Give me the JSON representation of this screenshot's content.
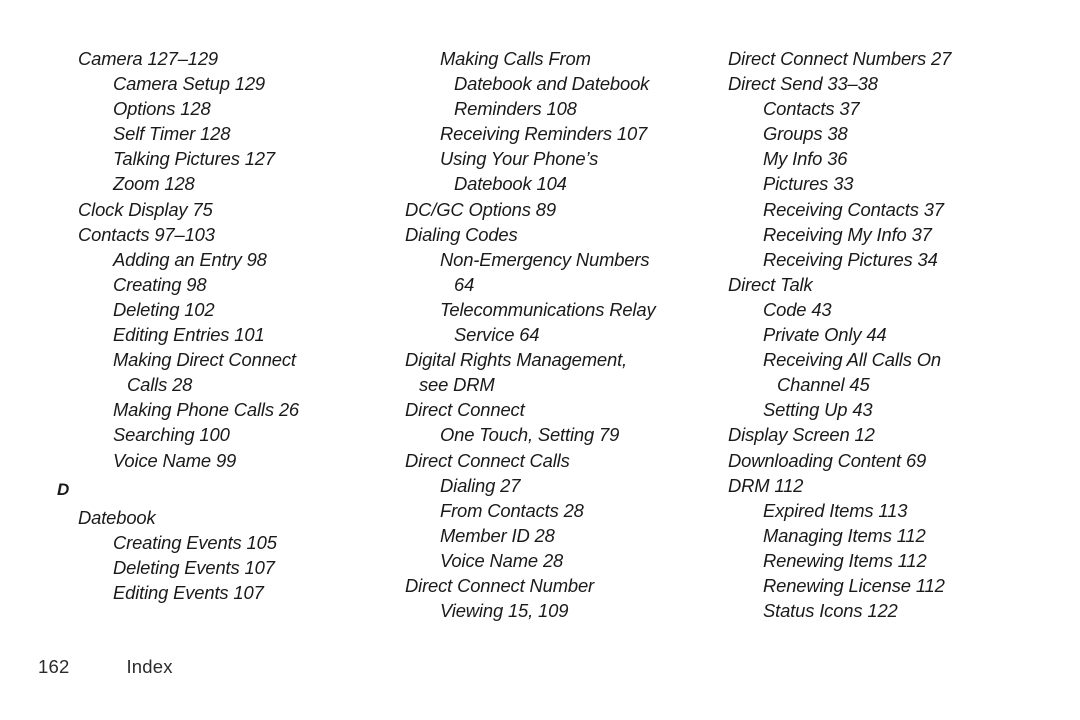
{
  "page": {
    "background_color": "#ffffff",
    "text_color": "#1a1a1a"
  },
  "footer": {
    "page_number": "162",
    "label": "Index"
  },
  "columns": [
    {
      "id": "column-1",
      "entries": [
        {
          "text": "Camera 127–129",
          "level": 1
        },
        {
          "text": "Camera Setup 129",
          "level": 2
        },
        {
          "text": "Options 128",
          "level": 2
        },
        {
          "text": "Self Timer 128",
          "level": 2
        },
        {
          "text": "Talking Pictures 127",
          "level": 2
        },
        {
          "text": "Zoom 128",
          "level": 2
        },
        {
          "text": "Clock Display 75",
          "level": 1
        },
        {
          "text": "Contacts 97–103",
          "level": 1
        },
        {
          "text": "Adding an Entry 98",
          "level": 2
        },
        {
          "text": "Creating 98",
          "level": 2
        },
        {
          "text": "Deleting 102",
          "level": 2
        },
        {
          "text": "Editing Entries 101",
          "level": 2
        },
        {
          "text": "Making Direct Connect Calls 28",
          "level": 2,
          "wrap": true
        },
        {
          "text": "Making Phone Calls 26",
          "level": 2
        },
        {
          "text": "Searching 100",
          "level": 2
        },
        {
          "text": "Voice Name 99",
          "level": 2
        },
        {
          "text": "D",
          "level": 0,
          "section": true
        },
        {
          "text": "Datebook",
          "level": 1
        },
        {
          "text": "Creating Events 105",
          "level": 2
        },
        {
          "text": "Deleting Events 107",
          "level": 2
        },
        {
          "text": "Editing Events 107",
          "level": 2
        }
      ]
    },
    {
      "id": "column-2",
      "entries": [
        {
          "text": "Making Calls From Datebook and Datebook Reminders 108",
          "level": 2,
          "wrap": true
        },
        {
          "text": "Receiving Reminders 107",
          "level": 2
        },
        {
          "text": "Using Your Phone’s Datebook 104",
          "level": 2,
          "wrap": true
        },
        {
          "text": "DC/GC Options 89",
          "level": 1
        },
        {
          "text": "Dialing Codes",
          "level": 1
        },
        {
          "text": "Non-Emergency Numbers 64",
          "level": 2,
          "wrap": true
        },
        {
          "text": "Telecommunications Relay Service 64",
          "level": 2,
          "wrap": true
        },
        {
          "text": "Digital Rights Management, see DRM",
          "level": 1,
          "wrap": true
        },
        {
          "text": "Direct Connect",
          "level": 1
        },
        {
          "text": "One Touch, Setting 79",
          "level": 2
        },
        {
          "text": "Direct Connect Calls",
          "level": 1
        },
        {
          "text": "Dialing 27",
          "level": 2
        },
        {
          "text": "From Contacts 28",
          "level": 2
        },
        {
          "text": "Member ID 28",
          "level": 2
        },
        {
          "text": "Voice Name 28",
          "level": 2
        },
        {
          "text": "Direct Connect Number",
          "level": 1
        },
        {
          "text": "Viewing 15, 109",
          "level": 2
        }
      ]
    },
    {
      "id": "column-3",
      "entries": [
        {
          "text": "Direct Connect Numbers 27",
          "level": 1
        },
        {
          "text": "Direct Send 33–38",
          "level": 1
        },
        {
          "text": "Contacts 37",
          "level": 2
        },
        {
          "text": "Groups 38",
          "level": 2
        },
        {
          "text": "My Info 36",
          "level": 2
        },
        {
          "text": "Pictures 33",
          "level": 2
        },
        {
          "text": "Receiving Contacts 37",
          "level": 2
        },
        {
          "text": "Receiving My Info 37",
          "level": 2
        },
        {
          "text": "Receiving Pictures 34",
          "level": 2
        },
        {
          "text": "Direct Talk",
          "level": 1
        },
        {
          "text": "Code 43",
          "level": 2
        },
        {
          "text": "Private Only 44",
          "level": 2
        },
        {
          "text": "Receiving All Calls On Channel 45",
          "level": 2,
          "wrap": true
        },
        {
          "text": "Setting Up 43",
          "level": 2
        },
        {
          "text": "Display Screen 12",
          "level": 1
        },
        {
          "text": "Downloading Content 69",
          "level": 1
        },
        {
          "text": "DRM 112",
          "level": 1
        },
        {
          "text": "Expired Items 113",
          "level": 2
        },
        {
          "text": "Managing Items 112",
          "level": 2
        },
        {
          "text": "Renewing Items 112",
          "level": 2
        },
        {
          "text": "Renewing License 112",
          "level": 2
        },
        {
          "text": "Status Icons 122",
          "level": 2
        }
      ]
    }
  ]
}
